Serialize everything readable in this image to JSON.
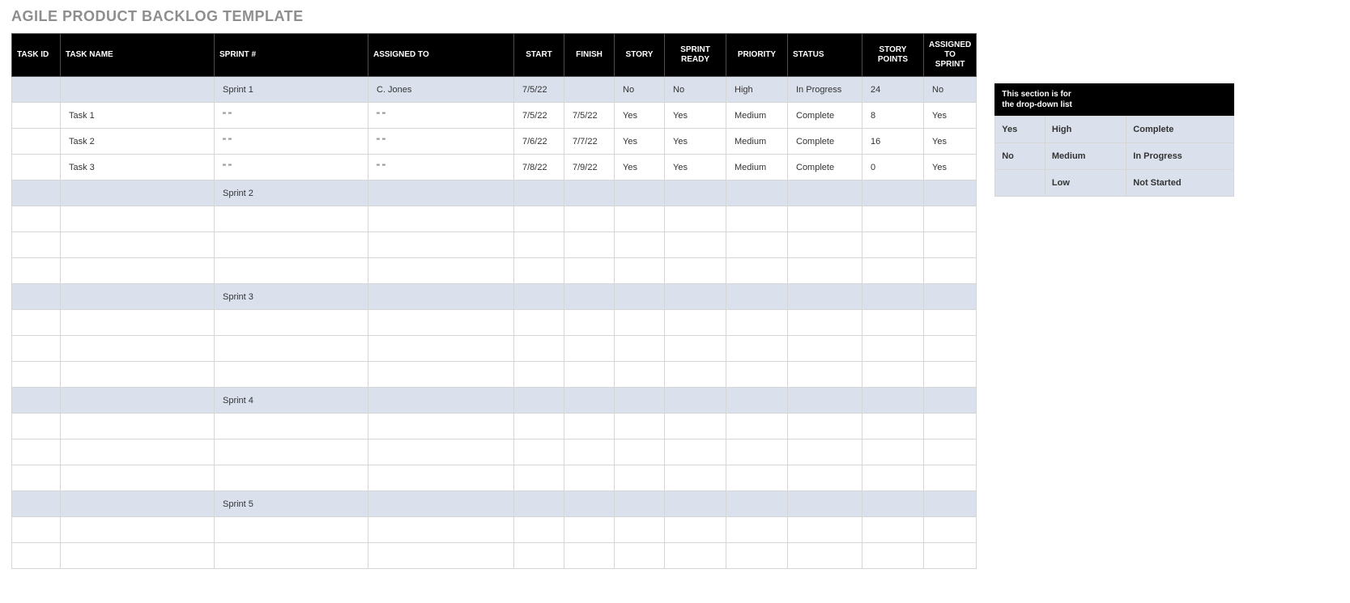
{
  "title": "AGILE PRODUCT BACKLOG TEMPLATE",
  "headers": [
    "TASK ID",
    "TASK NAME",
    "SPRINT #",
    "ASSIGNED TO",
    "START",
    "FINISH",
    "STORY",
    "SPRINT READY",
    "PRIORITY",
    "STATUS",
    "STORY POINTS",
    "ASSIGNED TO SPRINT"
  ],
  "rows": [
    {
      "type": "sprint",
      "cells": [
        "",
        "",
        "Sprint 1",
        "C. Jones",
        "7/5/22",
        "",
        "No",
        "No",
        "High",
        "In Progress",
        "24",
        "No"
      ]
    },
    {
      "type": "task",
      "cells": [
        "",
        "Task 1",
        "\" \"",
        "\" \"",
        "7/5/22",
        "7/5/22",
        "Yes",
        "Yes",
        "Medium",
        "Complete",
        "8",
        "Yes"
      ]
    },
    {
      "type": "task",
      "cells": [
        "",
        "Task 2",
        "\" \"",
        "\" \"",
        "7/6/22",
        "7/7/22",
        "Yes",
        "Yes",
        "Medium",
        "Complete",
        "16",
        "Yes"
      ]
    },
    {
      "type": "task",
      "cells": [
        "",
        "Task 3",
        "\" \"",
        "\" \"",
        "7/8/22",
        "7/9/22",
        "Yes",
        "Yes",
        "Medium",
        "Complete",
        "0",
        "Yes"
      ]
    },
    {
      "type": "sprint",
      "cells": [
        "",
        "",
        "Sprint 2",
        "",
        "",
        "",
        "",
        "",
        "",
        "",
        "",
        ""
      ]
    },
    {
      "type": "task",
      "cells": [
        "",
        "",
        "",
        "",
        "",
        "",
        "",
        "",
        "",
        "",
        "",
        ""
      ]
    },
    {
      "type": "task",
      "cells": [
        "",
        "",
        "",
        "",
        "",
        "",
        "",
        "",
        "",
        "",
        "",
        ""
      ]
    },
    {
      "type": "task",
      "cells": [
        "",
        "",
        "",
        "",
        "",
        "",
        "",
        "",
        "",
        "",
        "",
        ""
      ]
    },
    {
      "type": "sprint",
      "cells": [
        "",
        "",
        "Sprint 3",
        "",
        "",
        "",
        "",
        "",
        "",
        "",
        "",
        ""
      ]
    },
    {
      "type": "task",
      "cells": [
        "",
        "",
        "",
        "",
        "",
        "",
        "",
        "",
        "",
        "",
        "",
        ""
      ]
    },
    {
      "type": "task",
      "cells": [
        "",
        "",
        "",
        "",
        "",
        "",
        "",
        "",
        "",
        "",
        "",
        ""
      ]
    },
    {
      "type": "task",
      "cells": [
        "",
        "",
        "",
        "",
        "",
        "",
        "",
        "",
        "",
        "",
        "",
        ""
      ]
    },
    {
      "type": "sprint",
      "cells": [
        "",
        "",
        "Sprint 4",
        "",
        "",
        "",
        "",
        "",
        "",
        "",
        "",
        ""
      ]
    },
    {
      "type": "task",
      "cells": [
        "",
        "",
        "",
        "",
        "",
        "",
        "",
        "",
        "",
        "",
        "",
        ""
      ]
    },
    {
      "type": "task",
      "cells": [
        "",
        "",
        "",
        "",
        "",
        "",
        "",
        "",
        "",
        "",
        "",
        ""
      ]
    },
    {
      "type": "task",
      "cells": [
        "",
        "",
        "",
        "",
        "",
        "",
        "",
        "",
        "",
        "",
        "",
        ""
      ]
    },
    {
      "type": "sprint",
      "cells": [
        "",
        "",
        "Sprint 5",
        "",
        "",
        "",
        "",
        "",
        "",
        "",
        "",
        ""
      ]
    },
    {
      "type": "task",
      "cells": [
        "",
        "",
        "",
        "",
        "",
        "",
        "",
        "",
        "",
        "",
        "",
        ""
      ]
    },
    {
      "type": "task",
      "cells": [
        "",
        "",
        "",
        "",
        "",
        "",
        "",
        "",
        "",
        "",
        "",
        ""
      ]
    }
  ],
  "side": {
    "header_line1": "This section is for",
    "header_line2": "the drop-down list",
    "rows": [
      [
        "Yes",
        "High",
        "Complete"
      ],
      [
        "No",
        "Medium",
        "In Progress"
      ],
      [
        "",
        "Low",
        "Not Started"
      ]
    ]
  }
}
